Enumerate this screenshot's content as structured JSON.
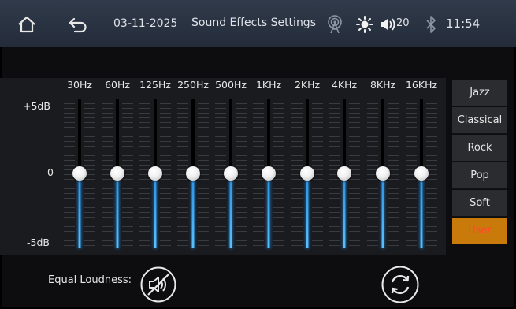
{
  "status_bar": {
    "date": "03-11-2025",
    "title": "Sound Effects Settings",
    "volume": "20",
    "time": "11:54",
    "icons": [
      "home-icon",
      "back-icon",
      "radio-antenna-icon",
      "brightness-icon",
      "volume-icon",
      "bluetooth-icon"
    ]
  },
  "equalizer": {
    "db_labels": {
      "top": "+5dB",
      "mid": "0",
      "bottom": "-5dB"
    },
    "range_db": [
      -5,
      5
    ],
    "bands": [
      {
        "label": "30Hz",
        "value_db": 0
      },
      {
        "label": "60Hz",
        "value_db": 0
      },
      {
        "label": "125Hz",
        "value_db": 0
      },
      {
        "label": "250Hz",
        "value_db": 0
      },
      {
        "label": "500Hz",
        "value_db": 0
      },
      {
        "label": "1KHz",
        "value_db": 0
      },
      {
        "label": "2KHz",
        "value_db": 0
      },
      {
        "label": "4KHz",
        "value_db": 0
      },
      {
        "label": "8KHz",
        "value_db": 0
      },
      {
        "label": "16KHz",
        "value_db": 0
      }
    ],
    "accent_color": "#2a8fe0"
  },
  "presets": {
    "items": [
      "Jazz",
      "Classical",
      "Rock",
      "Pop",
      "Soft",
      "User"
    ],
    "selected": "User",
    "selected_color": "#c87a0b"
  },
  "bottom": {
    "equal_loudness_label": "Equal Loudness:",
    "equal_loudness_icon": "speaker-muted-icon",
    "reset_icon": "refresh-icon"
  }
}
